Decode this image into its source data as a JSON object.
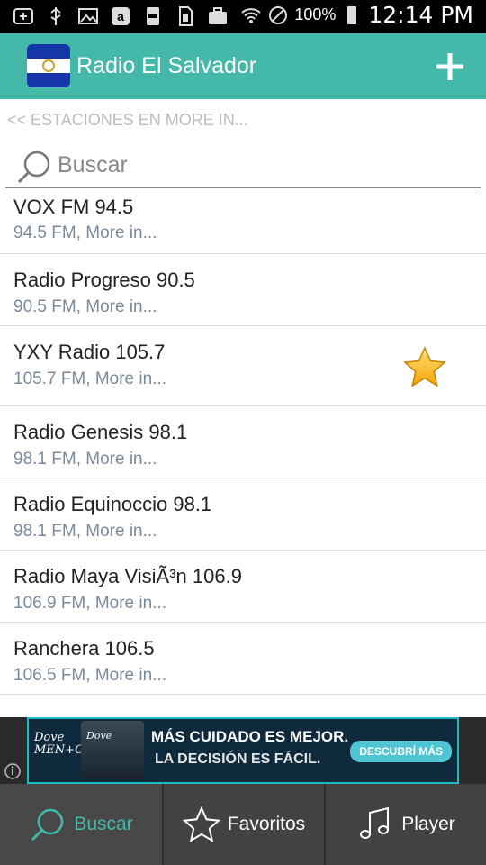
{
  "status_bar": {
    "battery": "100%",
    "time": "12:14 PM",
    "icons": [
      "add-icon",
      "usb-icon",
      "image-icon",
      "amazon-icon",
      "storage-icon",
      "sim-icon",
      "briefcase-icon",
      "wifi-icon",
      "do-not-disturb-icon",
      "battery-icon"
    ]
  },
  "app_bar": {
    "title": "Radio El Salvador",
    "add_icon": "plus-icon",
    "flag_icon": "el-salvador-flag-icon",
    "accent_color": "#44b9a9"
  },
  "crumb": "<< ESTACIONES EN MORE IN...",
  "search": {
    "placeholder": "Buscar",
    "value": ""
  },
  "stations": [
    {
      "name": "VOX FM 94.5",
      "subtitle": "94.5 FM, More in...",
      "favorite": false
    },
    {
      "name": "Radio Progreso 90.5",
      "subtitle": "90.5 FM, More in...",
      "favorite": false
    },
    {
      "name": "YXY Radio 105.7",
      "subtitle": "105.7 FM, More in...",
      "favorite": true
    },
    {
      "name": "Radio Genesis 98.1",
      "subtitle": "98.1 FM, More in...",
      "favorite": false
    },
    {
      "name": "Radio Equinoccio 98.1",
      "subtitle": "98.1 FM, More in...",
      "favorite": false
    },
    {
      "name": "Radio Maya VisiÃ³n 106.9",
      "subtitle": "106.9 FM, More in...",
      "favorite": false
    },
    {
      "name": "Ranchera 106.5",
      "subtitle": "106.5 FM, More in...",
      "favorite": false
    }
  ],
  "ad": {
    "brand": "Dove MEN+CARE",
    "line1": "MÁS CUIDADO ES MEJOR.",
    "line2": "LA DECISIÓN ES FÁCIL.",
    "cta": "DESCUBRÍ MÁS"
  },
  "bottom_nav": {
    "tabs": [
      {
        "label": "Buscar",
        "icon": "search-icon",
        "active": true
      },
      {
        "label": "Favoritos",
        "icon": "star-outline-icon",
        "active": false
      },
      {
        "label": "Player",
        "icon": "music-note-icon",
        "active": false
      }
    ]
  }
}
